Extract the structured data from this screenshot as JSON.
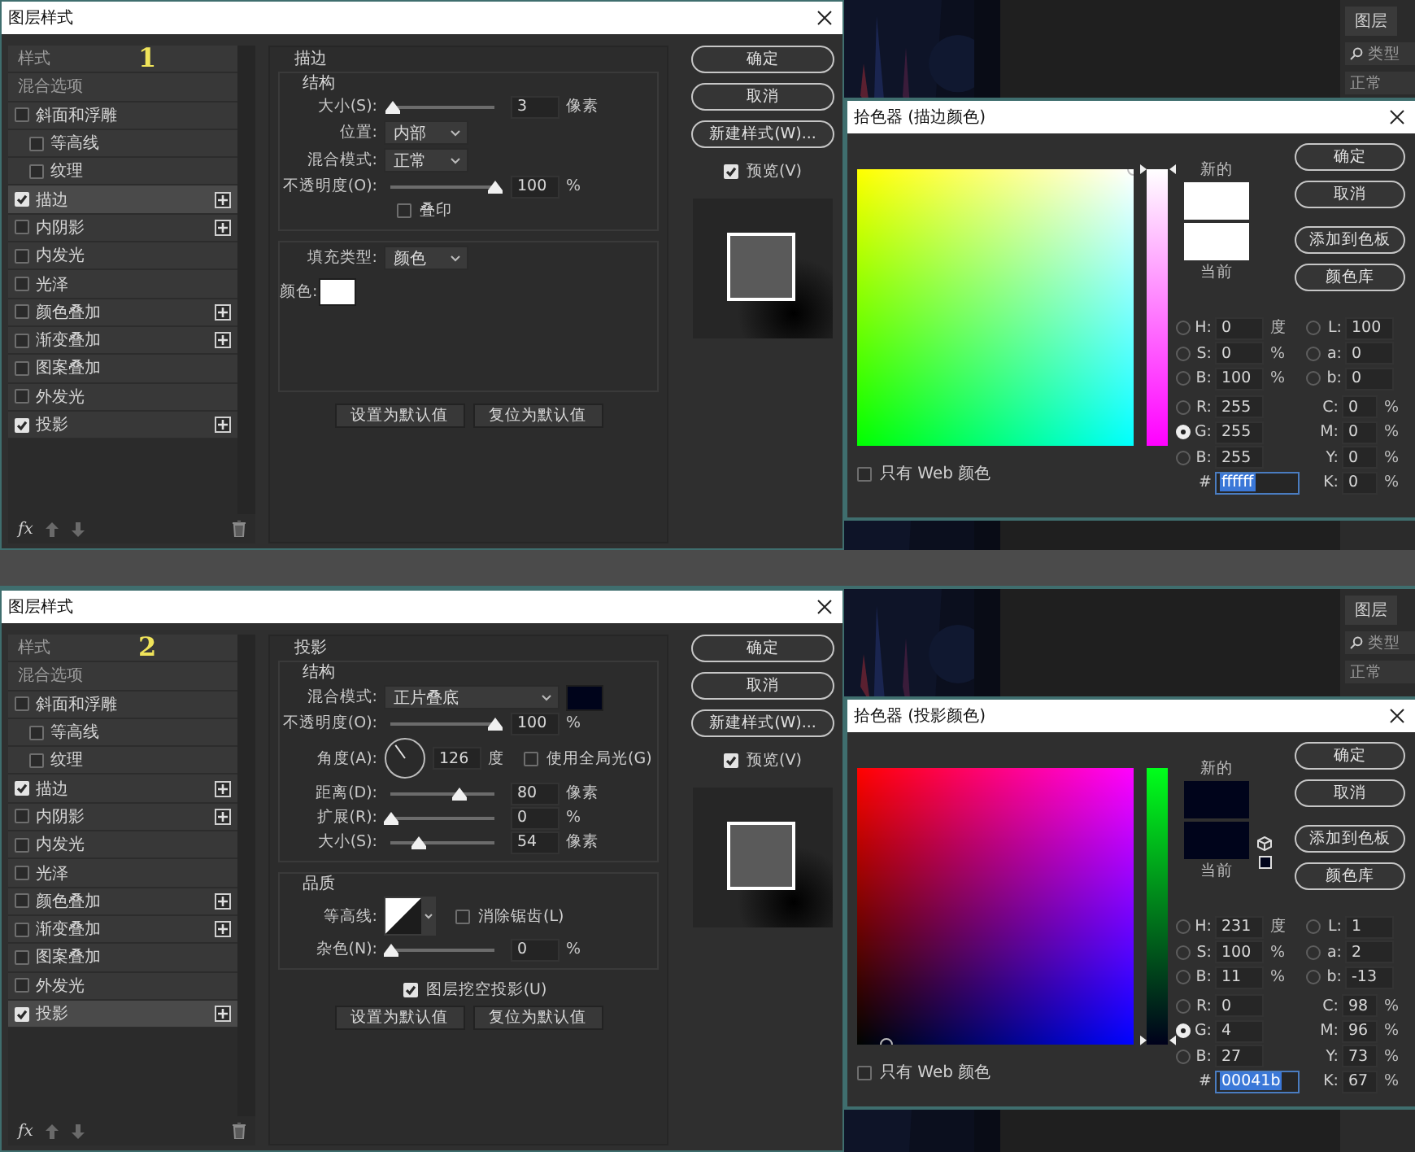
{
  "screens": [
    {
      "dialog": {
        "title": "图层样式",
        "styles": [
          {
            "kind": "header",
            "label": "样式",
            "selected": false,
            "step": "1"
          },
          {
            "kind": "header",
            "label": "混合选项",
            "selected": false
          },
          {
            "kind": "effect",
            "label": "斜面和浮雕",
            "selected": false,
            "checked": false,
            "addable": false,
            "children": [
              {
                "kind": "effect",
                "label": "等高线",
                "selected": false,
                "checked": false,
                "addable": false
              },
              {
                "kind": "effect",
                "label": "纹理",
                "selected": false,
                "checked": false,
                "addable": false
              }
            ]
          },
          {
            "kind": "effect",
            "label": "描边",
            "selected": true,
            "checked": true,
            "addable": true
          },
          {
            "kind": "effect",
            "label": "内阴影",
            "selected": false,
            "checked": false,
            "addable": true
          },
          {
            "kind": "effect",
            "label": "内发光",
            "selected": false,
            "checked": false,
            "addable": false
          },
          {
            "kind": "effect",
            "label": "光泽",
            "selected": false,
            "checked": false,
            "addable": false
          },
          {
            "kind": "effect",
            "label": "颜色叠加",
            "selected": false,
            "checked": false,
            "addable": true
          },
          {
            "kind": "effect",
            "label": "渐变叠加",
            "selected": false,
            "checked": false,
            "addable": true
          },
          {
            "kind": "effect",
            "label": "图案叠加",
            "selected": false,
            "checked": false,
            "addable": false
          },
          {
            "kind": "effect",
            "label": "外发光",
            "selected": false,
            "checked": false,
            "addable": false
          },
          {
            "kind": "effect",
            "label": "投影",
            "selected": false,
            "checked": true,
            "addable": true
          }
        ],
        "footer_label": "fx",
        "section": {
          "title": "描边",
          "groups": [
            {
              "title": "结构",
              "rows": [
                {
                  "kind": "slider",
                  "label": "大小(S):",
                  "level": 0.02,
                  "value": "3",
                  "unit": "像素"
                },
                {
                  "kind": "select",
                  "label": "位置:",
                  "value": "内部"
                },
                {
                  "kind": "select",
                  "label": "混合模式:",
                  "value": "正常"
                },
                {
                  "kind": "slider",
                  "label": "不透明度(O):",
                  "level": 1,
                  "value": "100",
                  "unit": "%"
                },
                {
                  "kind": "check",
                  "label": "叠印",
                  "checked": false
                }
              ]
            },
            {
              "rows": [
                {
                  "kind": "select",
                  "label": "填充类型:",
                  "value": "颜色"
                },
                {
                  "kind": "color",
                  "label": "颜色:",
                  "color": "#ffffff"
                }
              ]
            }
          ],
          "buttons": [
            "设置为默认值",
            "复位为默认值"
          ]
        },
        "actions": [
          "确定",
          "取消",
          "新建样式(W)..."
        ],
        "preview": {
          "label": "预览(V)",
          "checked": true
        }
      },
      "picker": {
        "title": "拾色器 (描边颜色)",
        "new_label": "新的",
        "current_label": "当前",
        "web_warning": false,
        "buttons": [
          "确定",
          "取消",
          "添加到色板",
          "颜色库"
        ],
        "hsb": [
          {
            "label": "H:",
            "value": "0",
            "unit": "度",
            "selected": false
          },
          {
            "label": "S:",
            "value": "0",
            "unit": "%",
            "selected": false
          },
          {
            "label": "B:",
            "value": "100",
            "unit": "%",
            "selected": false
          }
        ],
        "rgb": [
          {
            "label": "R:",
            "value": "255",
            "selected": false
          },
          {
            "label": "G:",
            "value": "255",
            "selected": true
          },
          {
            "label": "B:",
            "value": "255",
            "selected": false
          }
        ],
        "hex_label": "#",
        "hex": "ffffff",
        "lab": [
          {
            "label": "L:",
            "value": "100",
            "selected": false
          },
          {
            "label": "a:",
            "value": "0",
            "selected": false
          },
          {
            "label": "b:",
            "value": "0",
            "selected": false
          }
        ],
        "cmyk": [
          {
            "label": "C:",
            "value": "0",
            "unit": "%"
          },
          {
            "label": "M:",
            "value": "0",
            "unit": "%"
          },
          {
            "label": "Y:",
            "value": "0",
            "unit": "%"
          },
          {
            "label": "K:",
            "value": "0",
            "unit": "%"
          }
        ],
        "web_only": {
          "label": "只有 Web 颜色",
          "checked": false
        }
      },
      "app": {
        "panel_tab": "图层",
        "search_placeholder": "类型",
        "blend_mode": "正常"
      }
    },
    {
      "dialog": {
        "title": "图层样式",
        "styles": [
          {
            "kind": "header",
            "label": "样式",
            "selected": false,
            "step": "2"
          },
          {
            "kind": "header",
            "label": "混合选项",
            "selected": false
          },
          {
            "kind": "effect",
            "label": "斜面和浮雕",
            "selected": false,
            "checked": false,
            "addable": false,
            "children": [
              {
                "kind": "effect",
                "label": "等高线",
                "selected": false,
                "checked": false,
                "addable": false
              },
              {
                "kind": "effect",
                "label": "纹理",
                "selected": false,
                "checked": false,
                "addable": false
              }
            ]
          },
          {
            "kind": "effect",
            "label": "描边",
            "selected": false,
            "checked": true,
            "addable": true
          },
          {
            "kind": "effect",
            "label": "内阴影",
            "selected": false,
            "checked": false,
            "addable": true
          },
          {
            "kind": "effect",
            "label": "内发光",
            "selected": false,
            "checked": false,
            "addable": false
          },
          {
            "kind": "effect",
            "label": "光泽",
            "selected": false,
            "checked": false,
            "addable": false
          },
          {
            "kind": "effect",
            "label": "颜色叠加",
            "selected": false,
            "checked": false,
            "addable": true
          },
          {
            "kind": "effect",
            "label": "渐变叠加",
            "selected": false,
            "checked": false,
            "addable": true
          },
          {
            "kind": "effect",
            "label": "图案叠加",
            "selected": false,
            "checked": false,
            "addable": false
          },
          {
            "kind": "effect",
            "label": "外发光",
            "selected": false,
            "checked": false,
            "addable": false
          },
          {
            "kind": "effect",
            "label": "投影",
            "selected": true,
            "checked": true,
            "addable": true
          }
        ],
        "footer_label": "fx",
        "section": {
          "title": "投影",
          "groups": [
            {
              "title": "结构",
              "rows": [
                {
                  "kind": "select",
                  "label": "混合模式:",
                  "value": "正片叠底",
                  "color": "#00041b"
                },
                {
                  "kind": "slider",
                  "label": "不透明度(O):",
                  "level": 1,
                  "value": "100",
                  "unit": "%"
                },
                {
                  "kind": "angle",
                  "label": "角度(A):",
                  "value": "126",
                  "unit": "度",
                  "option": {
                    "label": "使用全局光(G)",
                    "checked": false
                  }
                },
                {
                  "kind": "slider",
                  "label": "距离(D):",
                  "level": 0.65,
                  "value": "80",
                  "unit": "像素"
                },
                {
                  "kind": "slider",
                  "label": "扩展(R):",
                  "level": 0,
                  "value": "0",
                  "unit": "%"
                },
                {
                  "kind": "slider",
                  "label": "大小(S):",
                  "level": 0.27,
                  "value": "54",
                  "unit": "像素"
                }
              ]
            },
            {
              "title": "品质",
              "rows": [
                {
                  "kind": "contour",
                  "label": "等高线:",
                  "option": {
                    "label": "消除锯齿(L)",
                    "checked": false
                  }
                },
                {
                  "kind": "slider",
                  "label": "杂色(N):",
                  "level": 0,
                  "value": "0",
                  "unit": "%"
                }
              ]
            }
          ],
          "footer_option": {
            "label": "图层挖空投影(U)",
            "checked": true
          },
          "buttons": [
            "设置为默认值",
            "复位为默认值"
          ]
        },
        "actions": [
          "确定",
          "取消",
          "新建样式(W)..."
        ],
        "preview": {
          "label": "预览(V)",
          "checked": true
        }
      },
      "picker": {
        "title": "拾色器 (投影颜色)",
        "new_label": "新的",
        "current_label": "当前",
        "web_warning": true,
        "buttons": [
          "确定",
          "取消",
          "添加到色板",
          "颜色库"
        ],
        "hsb": [
          {
            "label": "H:",
            "value": "231",
            "unit": "度",
            "selected": false
          },
          {
            "label": "S:",
            "value": "100",
            "unit": "%",
            "selected": false
          },
          {
            "label": "B:",
            "value": "11",
            "unit": "%",
            "selected": false
          }
        ],
        "rgb": [
          {
            "label": "R:",
            "value": "0",
            "selected": false
          },
          {
            "label": "G:",
            "value": "4",
            "selected": true
          },
          {
            "label": "B:",
            "value": "27",
            "selected": false
          }
        ],
        "hex_label": "#",
        "hex": "00041b",
        "lab": [
          {
            "label": "L:",
            "value": "1",
            "selected": false
          },
          {
            "label": "a:",
            "value": "2",
            "selected": false
          },
          {
            "label": "b:",
            "value": "-13",
            "selected": false
          }
        ],
        "cmyk": [
          {
            "label": "C:",
            "value": "98",
            "unit": "%"
          },
          {
            "label": "M:",
            "value": "96",
            "unit": "%"
          },
          {
            "label": "Y:",
            "value": "73",
            "unit": "%"
          },
          {
            "label": "K:",
            "value": "67",
            "unit": "%"
          }
        ],
        "web_only": {
          "label": "只有 Web 颜色",
          "checked": false
        }
      },
      "app": {
        "panel_tab": "图层",
        "search_placeholder": "类型",
        "blend_mode": "正常"
      }
    }
  ]
}
